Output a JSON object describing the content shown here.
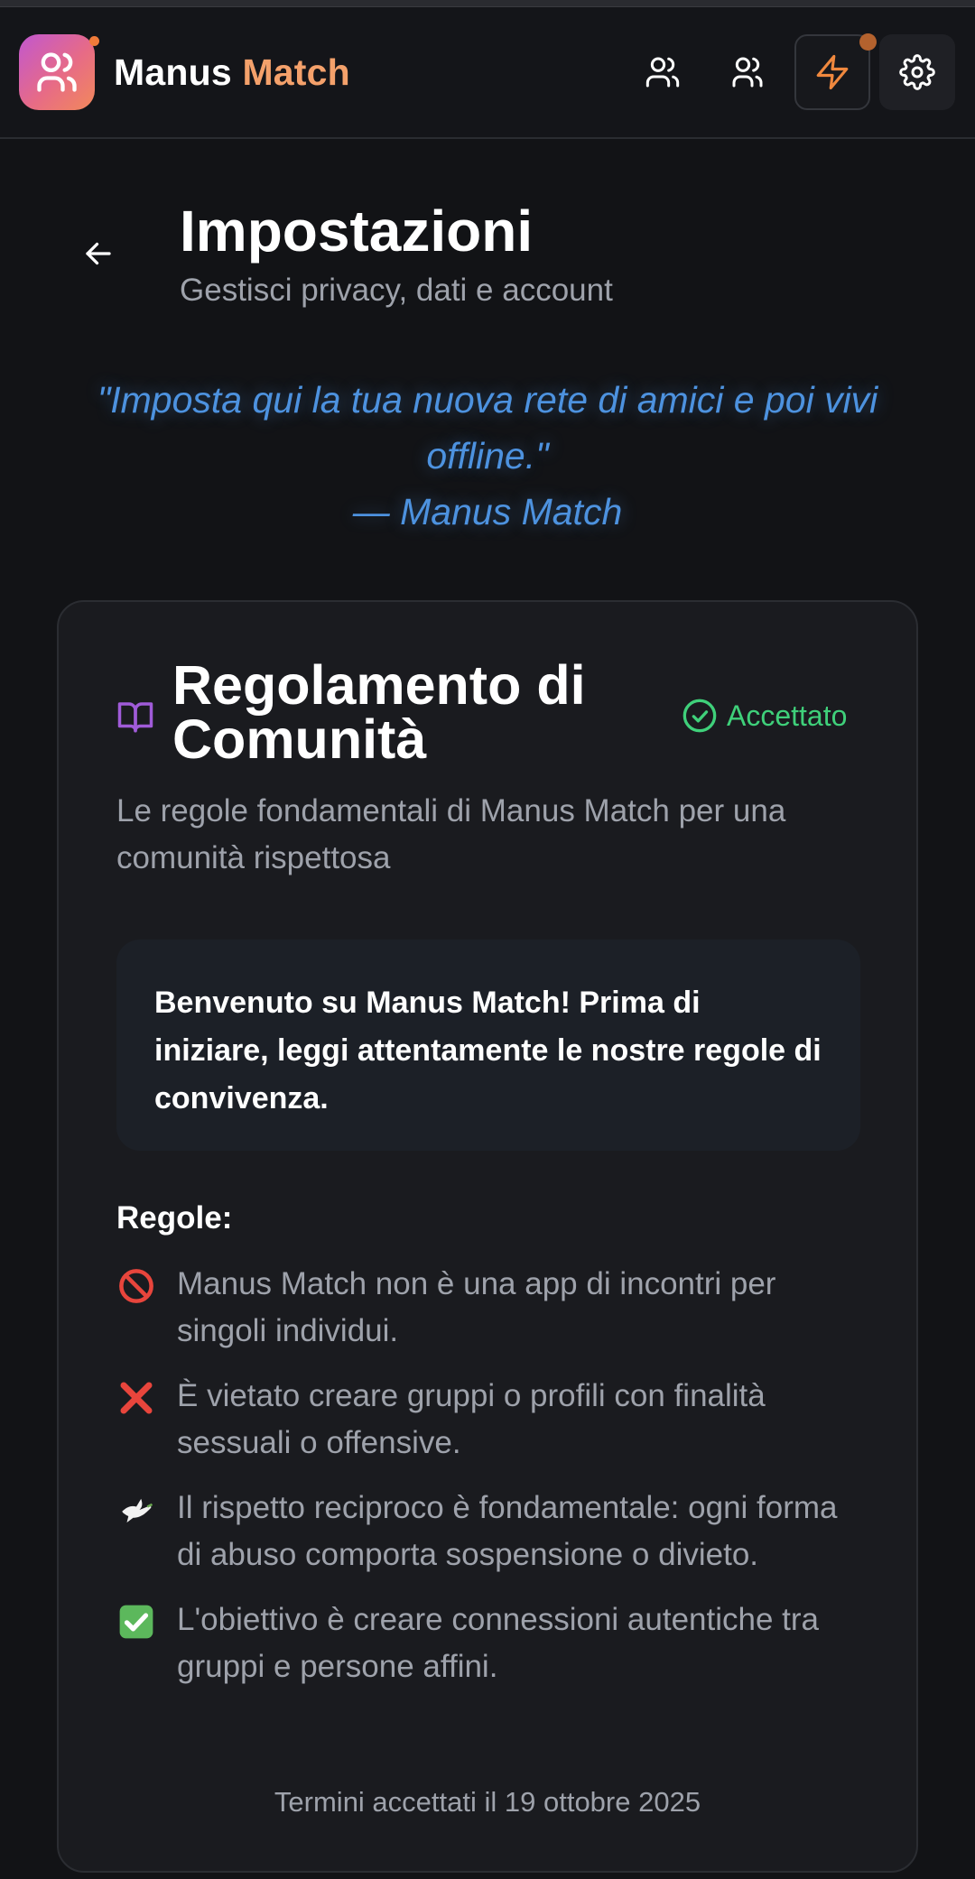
{
  "header": {
    "brand_part1": "Manus",
    "brand_part2": "Match",
    "buttons": [
      {
        "icon": "users-icon"
      },
      {
        "icon": "user-group-icon"
      },
      {
        "icon": "bolt-icon"
      },
      {
        "icon": "gear-icon"
      }
    ]
  },
  "page": {
    "title": "Impostazioni",
    "subtitle": "Gestisci privacy, dati e account"
  },
  "quote": {
    "text": "\"Imposta qui la tua nuova rete di amici e poi vivi offline.\"",
    "author": "— Manus Match"
  },
  "card": {
    "title": "Regolamento di Comunità",
    "status": "Accettato",
    "description": "Le regole fondamentali di Manus Match per una comunità rispettosa",
    "welcome": "Benvenuto su Manus Match! Prima di iniziare, leggi attentamente le nostre regole di convivenza.",
    "rules_heading": "Regole:",
    "rules": [
      {
        "icon": "🚫",
        "text": "Manus Match non è una app di incontri per singoli individui."
      },
      {
        "icon": "❌",
        "text": "È vietato creare gruppi o profili con finalità sessuali o offensive."
      },
      {
        "icon": "🕊️",
        "text": "Il rispetto reciproco è fondamentale: ogni forma di abuso comporta sospensione o divieto."
      },
      {
        "icon": "✅",
        "text": "L'obiettivo è creare connessioni autentiche tra gruppi e persone affini."
      }
    ],
    "terms": "Termini accettati il 19 ottobre 2025"
  },
  "colors": {
    "accent_orange": "#f4a16b",
    "quote_blue": "#4d92df",
    "success_green": "#3fd07a",
    "book_purple": "#a05bd8"
  }
}
